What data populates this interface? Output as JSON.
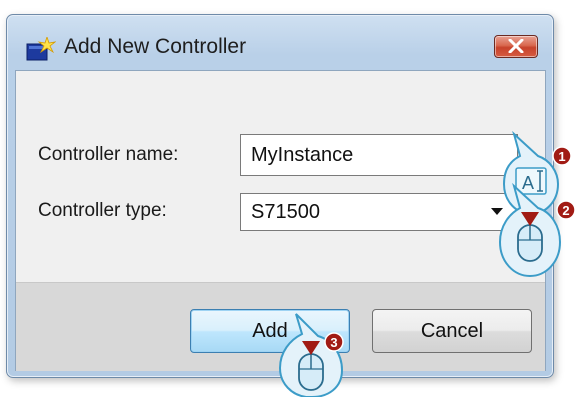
{
  "dialog": {
    "title": "Add New Controller"
  },
  "form": {
    "name_label": "Controller name:",
    "name_value": "MyInstance",
    "type_label": "Controller type:",
    "type_value": "S71500"
  },
  "buttons": {
    "add_label": "Add",
    "cancel_label": "Cancel"
  },
  "hints": [
    {
      "number": "1",
      "icon": "text-cursor-icon",
      "glyph": "A"
    },
    {
      "number": "2",
      "icon": "mouse-click-icon"
    },
    {
      "number": "3",
      "icon": "mouse-click-icon"
    }
  ],
  "colors": {
    "title_bar": "#b9d0e8",
    "close_button": "#c7422b",
    "default_button": "#bee6fd",
    "hint_bubble": "#e4f2fa",
    "hint_badge": "#a11b14"
  }
}
